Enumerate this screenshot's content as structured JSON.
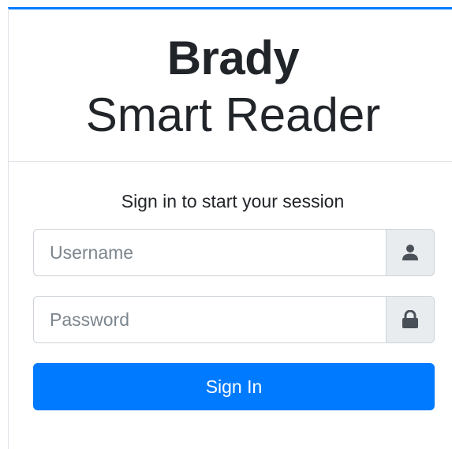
{
  "header": {
    "brand_line1": "Brady",
    "brand_line2": "Smart Reader"
  },
  "login": {
    "message": "Sign in to start your session",
    "username": {
      "placeholder": "Username",
      "value": "",
      "icon": "user-icon"
    },
    "password": {
      "placeholder": "Password",
      "value": "",
      "icon": "lock-icon"
    },
    "submit_label": "Sign In"
  },
  "colors": {
    "accent": "#007bff",
    "addon_bg": "#e9ecef",
    "text": "#212529",
    "icon": "#495057"
  }
}
